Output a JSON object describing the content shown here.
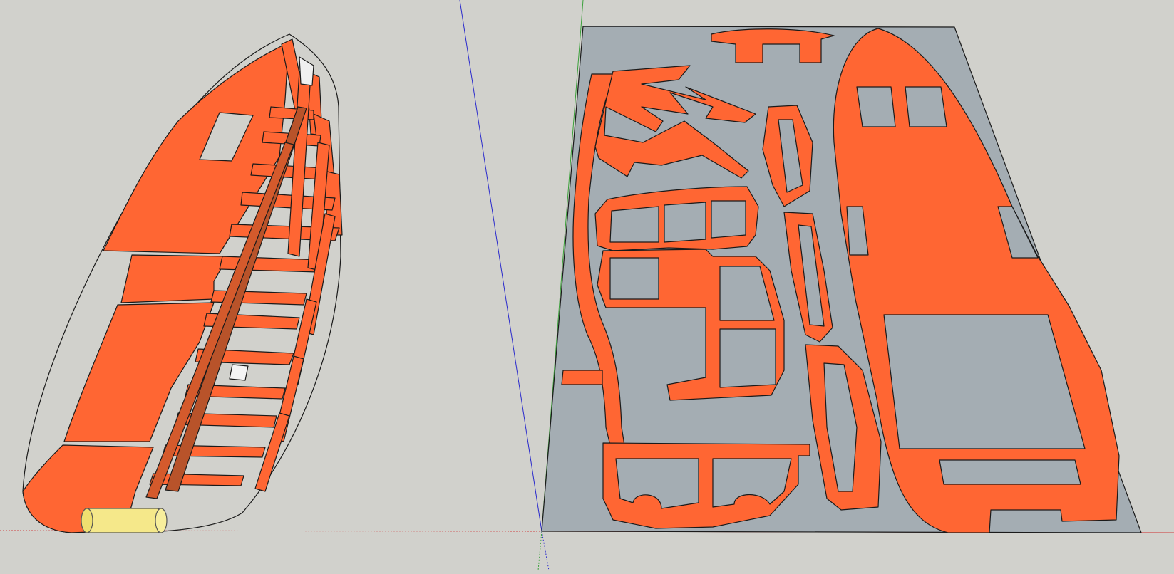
{
  "viewport": {
    "name": "3d-modeling-viewport",
    "background": "#d1d1cc"
  },
  "colors": {
    "part_fill": "#ff6633",
    "part_stroke": "#1a1a1a",
    "sheet_fill": "#a4adb3",
    "wheel_fill": "#f5e88a",
    "axis_red": "#d04040",
    "axis_green": "#3aa03a",
    "axis_blue": "#2a2acc"
  },
  "objects": [
    {
      "name": "assembled-fuselage-model",
      "description_icon": "3d-model-icon"
    },
    {
      "name": "flat-cut-sheet-layout",
      "description_icon": "cnc-sheet-icon"
    },
    {
      "name": "model-axes",
      "description_icon": "axes-icon"
    }
  ]
}
